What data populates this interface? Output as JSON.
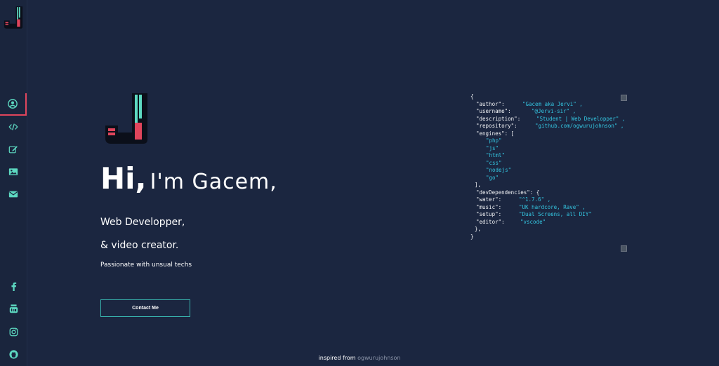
{
  "colors": {
    "background": "#1b2640",
    "accent_teal": "#5dd9c1",
    "accent_red": "#e0455c",
    "code_value": "#34c5e0"
  },
  "logo": {
    "letter": "J"
  },
  "nav": {
    "items": [
      {
        "icon": "user-circle-icon",
        "active": true
      },
      {
        "icon": "code-icon",
        "active": false
      },
      {
        "icon": "edit-icon",
        "active": false
      },
      {
        "icon": "image-icon",
        "active": false
      },
      {
        "icon": "envelope-icon",
        "active": false
      }
    ]
  },
  "socials": [
    {
      "icon": "facebook-icon"
    },
    {
      "icon": "youtube-icon"
    },
    {
      "icon": "instagram-icon"
    },
    {
      "icon": "github-icon"
    }
  ],
  "hero": {
    "hi": "Hi,",
    "name": "I'm Gacem,",
    "role_line1": "Web Developper,",
    "role_line2": "& video creator.",
    "tagline": "Passionate with unsual techs",
    "contact_label": "Contact Me"
  },
  "code": {
    "open": "{",
    "close": "}",
    "author_key": "\"author\":",
    "author_val": "\"Gacem aka Jervi\" ,",
    "username_key": "\"username\":",
    "username_val": "\"@Jervi-sir\" ,",
    "description_key": "\"description\":",
    "description_val": "\"Student | Web Developper\" ,",
    "repository_key": "\"repository\":",
    "repository_val": "\"github.com/ogwurujohnson\" ,",
    "engines_key": "\"engines\": [",
    "engines": [
      "\"php\"",
      "\"js\"",
      "\"html\"",
      "\"css\"",
      "\"nodejs\"",
      "\"go\""
    ],
    "engines_close": "],",
    "devdeps_key": "\"devDependencies\": {",
    "water_key": "\"water\":",
    "water_val": "\"^1.7.6\" ,",
    "music_key": "\"music\":",
    "music_val": "\"UK hardcore, Rave\" ,",
    "setup_key": "\"setup\":",
    "setup_val": "\"Dual Screens, all DIY\"",
    "editor_key": "\"editor\":",
    "editor_val": "\"vscode\"",
    "devdeps_close": "},"
  },
  "footer": {
    "prefix": "inspired from",
    "credit": "ogwurujohnson"
  }
}
